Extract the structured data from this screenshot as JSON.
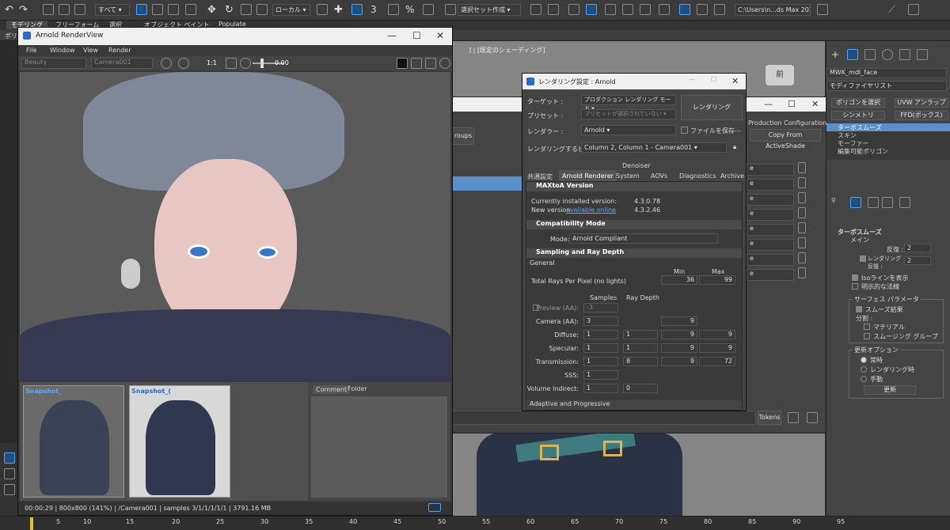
{
  "toolbar": {
    "filter_value": "すべて",
    "coord_value": "ローカル",
    "selection_set": "選択セット作成",
    "path": "C:\\Users\\n...ds Max 2022"
  },
  "ribbon": {
    "tabs": [
      "モデリング",
      "フリーフォーム",
      "選択",
      "オブジェクト ペイント",
      "Populate"
    ],
    "sub_label": "ポリゴン"
  },
  "viewport": {
    "label": "] | [既定のシェーディング]",
    "cube_label": "前"
  },
  "render_view": {
    "title": "Arnold RenderView",
    "menu": [
      "File",
      "Window",
      "View",
      "Render"
    ],
    "aov": "Beauty",
    "camera": "Camera001",
    "ratio": "1:1",
    "exposure": "0.00",
    "snapshots": [
      "Snapshot_",
      "Snapshot_("
    ],
    "panel_tabs": [
      "Comment",
      "Folder"
    ],
    "status": "00:00:29 | 800x800 (141%) | /Camera001 | samples 3/1/1/1/1/1 | 3791.16 MB"
  },
  "render_setup": {
    "title": "レンダリング設定 : Arnold",
    "target_label": "ターゲット :",
    "target_value": "プロダクション レンダリング モード",
    "preset_label": "プリセット :",
    "preset_value": "プリセットが選択されていない",
    "renderer_label": "レンダラー :",
    "renderer_value": "Arnold",
    "save_file": "ファイルを保存",
    "view_label": "レンダリングするビュー :",
    "view_value": "Column 2, Column 1 - Camera001",
    "render_btn": "レンダリング",
    "denoiser": "Denoiser",
    "tabs": [
      "共通設定",
      "Arnold Renderer",
      "System",
      "AOVs",
      "Diagnostics",
      "Archive"
    ],
    "active_tab": "Arnold Renderer",
    "maxtoa": {
      "title": "MAXtoA Version",
      "installed_label": "Currently installed version:",
      "installed_value": "4.3.0.78",
      "new_label": "New version",
      "new_link": "available online",
      "new_value": "4.3.2.46"
    },
    "compat": {
      "title": "Compatibility Mode",
      "mode_label": "Mode:",
      "mode_value": "Arnold Compliant"
    },
    "sampling": {
      "title": "Sampling and Ray Depth",
      "general": "General",
      "min_label": "Min",
      "max_label": "Max",
      "total_label": "Total Rays Per Pixel (no lights)",
      "total_min": "36",
      "total_max": "99",
      "samples_header": "Samples",
      "raydepth_header": "Ray Depth",
      "rows": [
        {
          "label": "Preview (AA):",
          "samples": "-3",
          "depth": "",
          "min": "",
          "max": ""
        },
        {
          "label": "Camera (AA):",
          "samples": "3",
          "depth": "",
          "min": "9",
          "max": ""
        },
        {
          "label": "Diffuse:",
          "samples": "1",
          "depth": "1",
          "min": "9",
          "max": "9"
        },
        {
          "label": "Specular:",
          "samples": "1",
          "depth": "1",
          "min": "9",
          "max": "9"
        },
        {
          "label": "Transmission:",
          "samples": "1",
          "depth": "8",
          "min": "9",
          "max": "72"
        },
        {
          "label": "SSS:",
          "samples": "1",
          "depth": "",
          "min": "",
          "max": ""
        },
        {
          "label": "Volume Indirect:",
          "samples": "1",
          "depth": "0",
          "min": "",
          "max": ""
        }
      ]
    },
    "adaptive": "Adaptive and Progressive"
  },
  "scene_explorer": {
    "groups_label": "roups",
    "production": "Production Configuration",
    "copy_btn": "Copy From ActiveShade",
    "tokens": "Tokens",
    "rows": [
      "e",
      "e",
      "e",
      "e",
      "e",
      "e",
      "e",
      "e"
    ]
  },
  "command_panel": {
    "object_name": "MWK_mdl_face",
    "modifier_list": "モディファイヤリスト",
    "btns": [
      "ポリゴンを選択",
      "UVW アンラップ",
      "シンメトリ",
      "FFD(ボックス)"
    ],
    "stack": [
      "ターボスムーズ",
      "スキン",
      "モーファー",
      "編集可能ポリゴン"
    ],
    "rollout_title": "ターボスムーズ",
    "main": "メイン",
    "iterations_label": "反復 :",
    "iterations_value": "2",
    "render_iter_label": "レンダリング反復 :",
    "render_iter_value": "2",
    "isoline": "Isoラインを表示",
    "explicit_normals": "明示的な法線",
    "surface_group": "サーフェス パラメータ",
    "smooth_result": "スムーズ結果",
    "separate": "分割 :",
    "material": "マテリアル",
    "smoothing_groups": "スムージング グループ",
    "update_group": "更新オプション",
    "always": "常時",
    "when_rendering": "レンダリング時",
    "manual": "手動",
    "update_btn": "更新"
  },
  "timeline": {
    "ticks": [
      "5",
      "10",
      "15",
      "20",
      "25",
      "30",
      "35",
      "40",
      "45",
      "50",
      "55",
      "60",
      "65",
      "70",
      "75",
      "80",
      "85",
      "90",
      "95"
    ]
  }
}
